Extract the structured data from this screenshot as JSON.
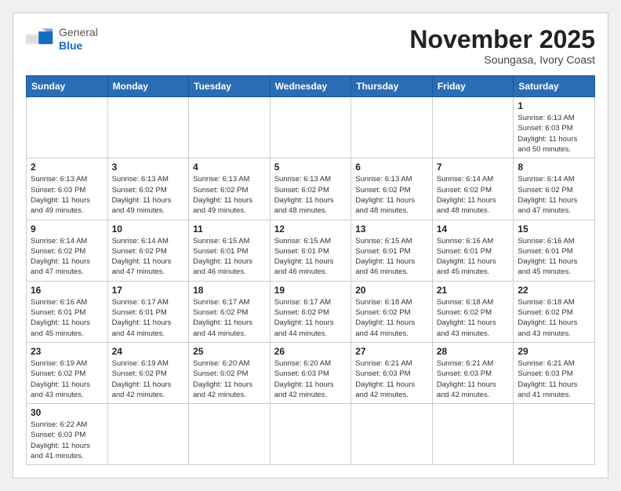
{
  "header": {
    "logo_general": "General",
    "logo_blue": "Blue",
    "month_title": "November 2025",
    "subtitle": "Soungasa, Ivory Coast"
  },
  "days_of_week": [
    "Sunday",
    "Monday",
    "Tuesday",
    "Wednesday",
    "Thursday",
    "Friday",
    "Saturday"
  ],
  "weeks": [
    [
      {
        "day": "",
        "info": ""
      },
      {
        "day": "",
        "info": ""
      },
      {
        "day": "",
        "info": ""
      },
      {
        "day": "",
        "info": ""
      },
      {
        "day": "",
        "info": ""
      },
      {
        "day": "",
        "info": ""
      },
      {
        "day": "1",
        "info": "Sunrise: 6:13 AM\nSunset: 6:03 PM\nDaylight: 11 hours\nand 50 minutes."
      }
    ],
    [
      {
        "day": "2",
        "info": "Sunrise: 6:13 AM\nSunset: 6:03 PM\nDaylight: 11 hours\nand 49 minutes."
      },
      {
        "day": "3",
        "info": "Sunrise: 6:13 AM\nSunset: 6:02 PM\nDaylight: 11 hours\nand 49 minutes."
      },
      {
        "day": "4",
        "info": "Sunrise: 6:13 AM\nSunset: 6:02 PM\nDaylight: 11 hours\nand 49 minutes."
      },
      {
        "day": "5",
        "info": "Sunrise: 6:13 AM\nSunset: 6:02 PM\nDaylight: 11 hours\nand 48 minutes."
      },
      {
        "day": "6",
        "info": "Sunrise: 6:13 AM\nSunset: 6:02 PM\nDaylight: 11 hours\nand 48 minutes."
      },
      {
        "day": "7",
        "info": "Sunrise: 6:14 AM\nSunset: 6:02 PM\nDaylight: 11 hours\nand 48 minutes."
      },
      {
        "day": "8",
        "info": "Sunrise: 6:14 AM\nSunset: 6:02 PM\nDaylight: 11 hours\nand 47 minutes."
      }
    ],
    [
      {
        "day": "9",
        "info": "Sunrise: 6:14 AM\nSunset: 6:02 PM\nDaylight: 11 hours\nand 47 minutes."
      },
      {
        "day": "10",
        "info": "Sunrise: 6:14 AM\nSunset: 6:02 PM\nDaylight: 11 hours\nand 47 minutes."
      },
      {
        "day": "11",
        "info": "Sunrise: 6:15 AM\nSunset: 6:01 PM\nDaylight: 11 hours\nand 46 minutes."
      },
      {
        "day": "12",
        "info": "Sunrise: 6:15 AM\nSunset: 6:01 PM\nDaylight: 11 hours\nand 46 minutes."
      },
      {
        "day": "13",
        "info": "Sunrise: 6:15 AM\nSunset: 6:01 PM\nDaylight: 11 hours\nand 46 minutes."
      },
      {
        "day": "14",
        "info": "Sunrise: 6:16 AM\nSunset: 6:01 PM\nDaylight: 11 hours\nand 45 minutes."
      },
      {
        "day": "15",
        "info": "Sunrise: 6:16 AM\nSunset: 6:01 PM\nDaylight: 11 hours\nand 45 minutes."
      }
    ],
    [
      {
        "day": "16",
        "info": "Sunrise: 6:16 AM\nSunset: 6:01 PM\nDaylight: 11 hours\nand 45 minutes."
      },
      {
        "day": "17",
        "info": "Sunrise: 6:17 AM\nSunset: 6:01 PM\nDaylight: 11 hours\nand 44 minutes."
      },
      {
        "day": "18",
        "info": "Sunrise: 6:17 AM\nSunset: 6:02 PM\nDaylight: 11 hours\nand 44 minutes."
      },
      {
        "day": "19",
        "info": "Sunrise: 6:17 AM\nSunset: 6:02 PM\nDaylight: 11 hours\nand 44 minutes."
      },
      {
        "day": "20",
        "info": "Sunrise: 6:18 AM\nSunset: 6:02 PM\nDaylight: 11 hours\nand 44 minutes."
      },
      {
        "day": "21",
        "info": "Sunrise: 6:18 AM\nSunset: 6:02 PM\nDaylight: 11 hours\nand 43 minutes."
      },
      {
        "day": "22",
        "info": "Sunrise: 6:18 AM\nSunset: 6:02 PM\nDaylight: 11 hours\nand 43 minutes."
      }
    ],
    [
      {
        "day": "23",
        "info": "Sunrise: 6:19 AM\nSunset: 6:02 PM\nDaylight: 11 hours\nand 43 minutes."
      },
      {
        "day": "24",
        "info": "Sunrise: 6:19 AM\nSunset: 6:02 PM\nDaylight: 11 hours\nand 42 minutes."
      },
      {
        "day": "25",
        "info": "Sunrise: 6:20 AM\nSunset: 6:02 PM\nDaylight: 11 hours\nand 42 minutes."
      },
      {
        "day": "26",
        "info": "Sunrise: 6:20 AM\nSunset: 6:03 PM\nDaylight: 11 hours\nand 42 minutes."
      },
      {
        "day": "27",
        "info": "Sunrise: 6:21 AM\nSunset: 6:03 PM\nDaylight: 11 hours\nand 42 minutes."
      },
      {
        "day": "28",
        "info": "Sunrise: 6:21 AM\nSunset: 6:03 PM\nDaylight: 11 hours\nand 42 minutes."
      },
      {
        "day": "29",
        "info": "Sunrise: 6:21 AM\nSunset: 6:03 PM\nDaylight: 11 hours\nand 41 minutes."
      }
    ],
    [
      {
        "day": "30",
        "info": "Sunrise: 6:22 AM\nSunset: 6:03 PM\nDaylight: 11 hours\nand 41 minutes."
      },
      {
        "day": "",
        "info": ""
      },
      {
        "day": "",
        "info": ""
      },
      {
        "day": "",
        "info": ""
      },
      {
        "day": "",
        "info": ""
      },
      {
        "day": "",
        "info": ""
      },
      {
        "day": "",
        "info": ""
      }
    ]
  ]
}
